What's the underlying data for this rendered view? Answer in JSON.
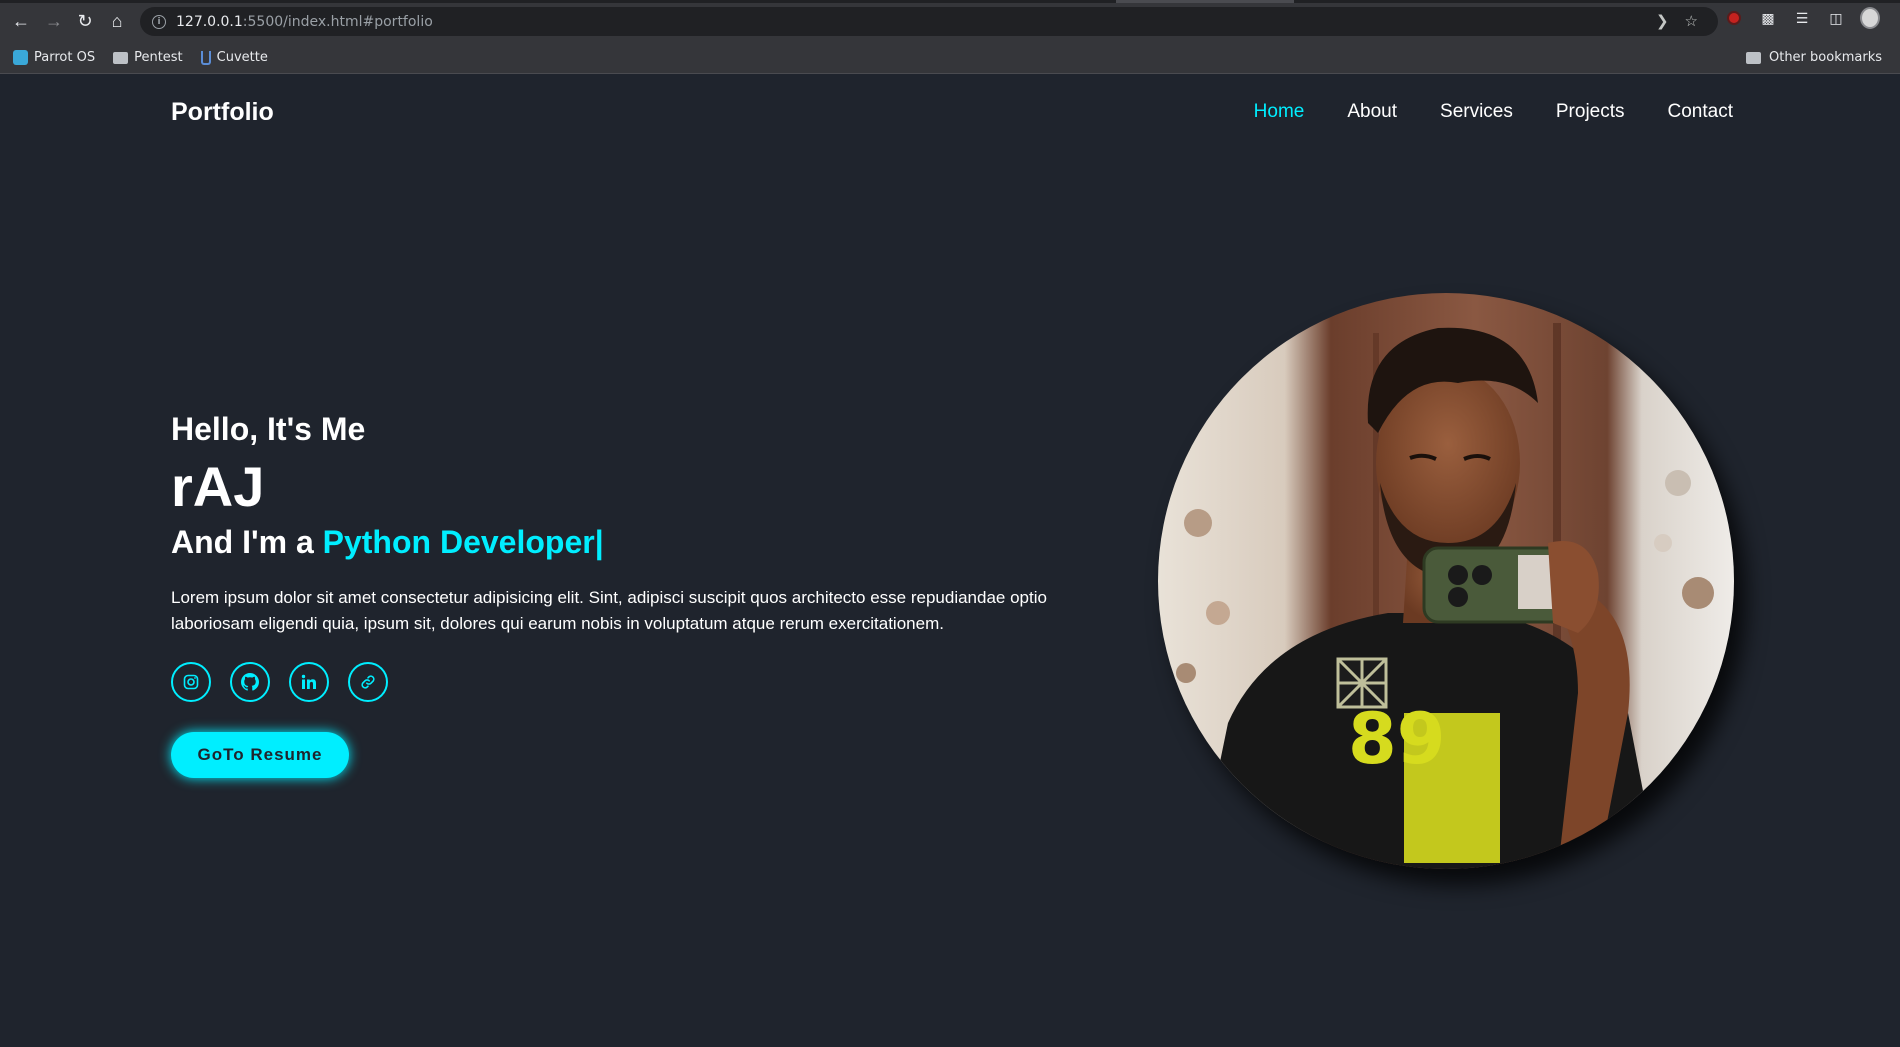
{
  "browser": {
    "url_host": "127.0.0.1",
    "url_rest": ":5500/index.html#portfolio",
    "bookmarks": [
      "Parrot OS",
      "Pentest",
      "Cuvette"
    ],
    "other_bookmarks": "Other bookmarks"
  },
  "site": {
    "logo": "Portfolio",
    "nav": [
      "Home",
      "About",
      "Services",
      "Projects",
      "Contact"
    ],
    "active_nav": "Home"
  },
  "hero": {
    "greeting": "Hello, It's Me",
    "name": "rAJ",
    "role_prefix": "And I'm a",
    "role": "Python Developer",
    "cursor": "|",
    "description": "Lorem ipsum dolor sit amet consectetur adipisicing elit. Sint, adipisci suscipit quos architecto esse repudiandae optio laboriosam eligendi quia, ipsum sit, dolores qui earum nobis in voluptatum atque rerum exercitationem.",
    "social_icons": [
      "instagram-icon",
      "github-icon",
      "linkedin-icon",
      "link-icon"
    ],
    "button_label": "GoTo Resume"
  },
  "colors": {
    "background": "#1f242d",
    "accent": "#00eeff",
    "text": "#ffffff"
  }
}
